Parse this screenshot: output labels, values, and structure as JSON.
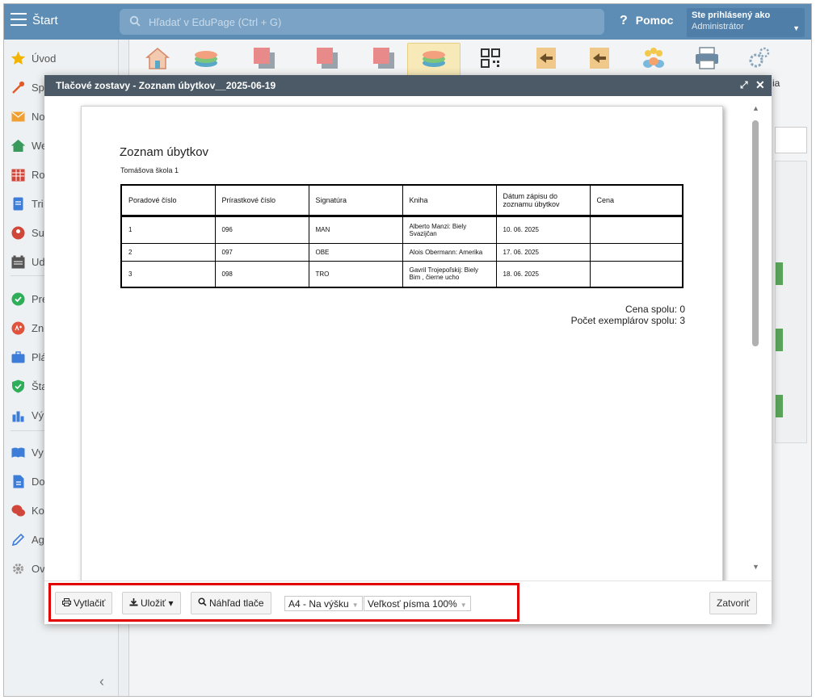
{
  "topbar": {
    "app_title": "Štart",
    "search_placeholder": "Hľadať v EduPage (Ctrl + G)",
    "help_label": "Pomoc",
    "user_line1": "Ste prihlásený ako",
    "user_line2": "Administrátor"
  },
  "sidebar": {
    "items": [
      {
        "label": "Úvod",
        "icon": "star-icon",
        "color": "#f2b400"
      },
      {
        "label": "Sp",
        "icon": "magic-wand-icon",
        "color": "#e05a2a"
      },
      {
        "label": "No",
        "icon": "envelope-icon",
        "color": "#f0a030"
      },
      {
        "label": "We",
        "icon": "house-icon",
        "color": "#3a9a5c"
      },
      {
        "label": "Ro",
        "icon": "calendar-grid-icon",
        "color": "#d0473a"
      },
      {
        "label": "Tri",
        "icon": "document-icon",
        "color": "#3b7dd8"
      },
      {
        "label": "Su",
        "icon": "person-icon",
        "color": "#d0473a"
      },
      {
        "label": "Ud",
        "icon": "calendar-icon",
        "color": "#555555"
      },
      {
        "label": "Pre",
        "icon": "check-circle-icon",
        "color": "#2fae5a"
      },
      {
        "label": "Zn",
        "icon": "grade-icon",
        "color": "#e0533d"
      },
      {
        "label": "Plá",
        "icon": "briefcase-icon",
        "color": "#3b7dd8"
      },
      {
        "label": "Šta",
        "icon": "shield-check-icon",
        "color": "#2fae5a"
      },
      {
        "label": "Vý",
        "icon": "bar-chart-icon",
        "color": "#3b7dd8"
      },
      {
        "label": "Vy",
        "icon": "book-open-icon",
        "color": "#3b7dd8"
      },
      {
        "label": "Do",
        "icon": "file-icon",
        "color": "#3b7dd8"
      },
      {
        "label": "Ko",
        "icon": "chat-icon",
        "color": "#d0473a"
      },
      {
        "label": "Ag",
        "icon": "pencil-icon",
        "color": "#3b7dd8"
      },
      {
        "label": "Ov",
        "icon": "gear-icon",
        "color": "#999999"
      }
    ]
  },
  "content": {
    "toolbar_note": "ia"
  },
  "modal": {
    "title": "Tlačové zostavy - Zoznam úbytkov__2025-06-19",
    "report": {
      "title": "Zoznam úbytkov",
      "school": "Tomášova škola 1",
      "columns": [
        "Poradové číslo",
        "Prírastkové číslo",
        "Signatúra",
        "Kniha",
        "Dátum zápisu do zoznamu úbytkov",
        "Cena"
      ],
      "rows": [
        [
          "1",
          "096",
          "MAN",
          "Alberto Manzi: Biely Svazijčan",
          "10. 06. 2025",
          ""
        ],
        [
          "2",
          "097",
          "OBE",
          "Alois Obermann: Amerika",
          "17. 06. 2025",
          ""
        ],
        [
          "3",
          "098",
          "TRO",
          "Gavril Trojepoľskij: Biely Bim , čierne ucho",
          "18. 06. 2025",
          ""
        ]
      ],
      "total_price": "Cena spolu: 0",
      "total_copies": "Počet exemplárov spolu: 3"
    },
    "footer": {
      "print_label": "Vytlačiť",
      "save_label": "Uložiť ▾",
      "preview_label": "Náhľad tlače",
      "paper_select": "A4 - Na výšku",
      "font_select": "Veľkosť písma 100%",
      "close_label": "Zatvoriť"
    }
  },
  "colors": {
    "topbar": "#5d8db4",
    "modal_header": "#4b5a66",
    "highlight": "#e00000"
  }
}
